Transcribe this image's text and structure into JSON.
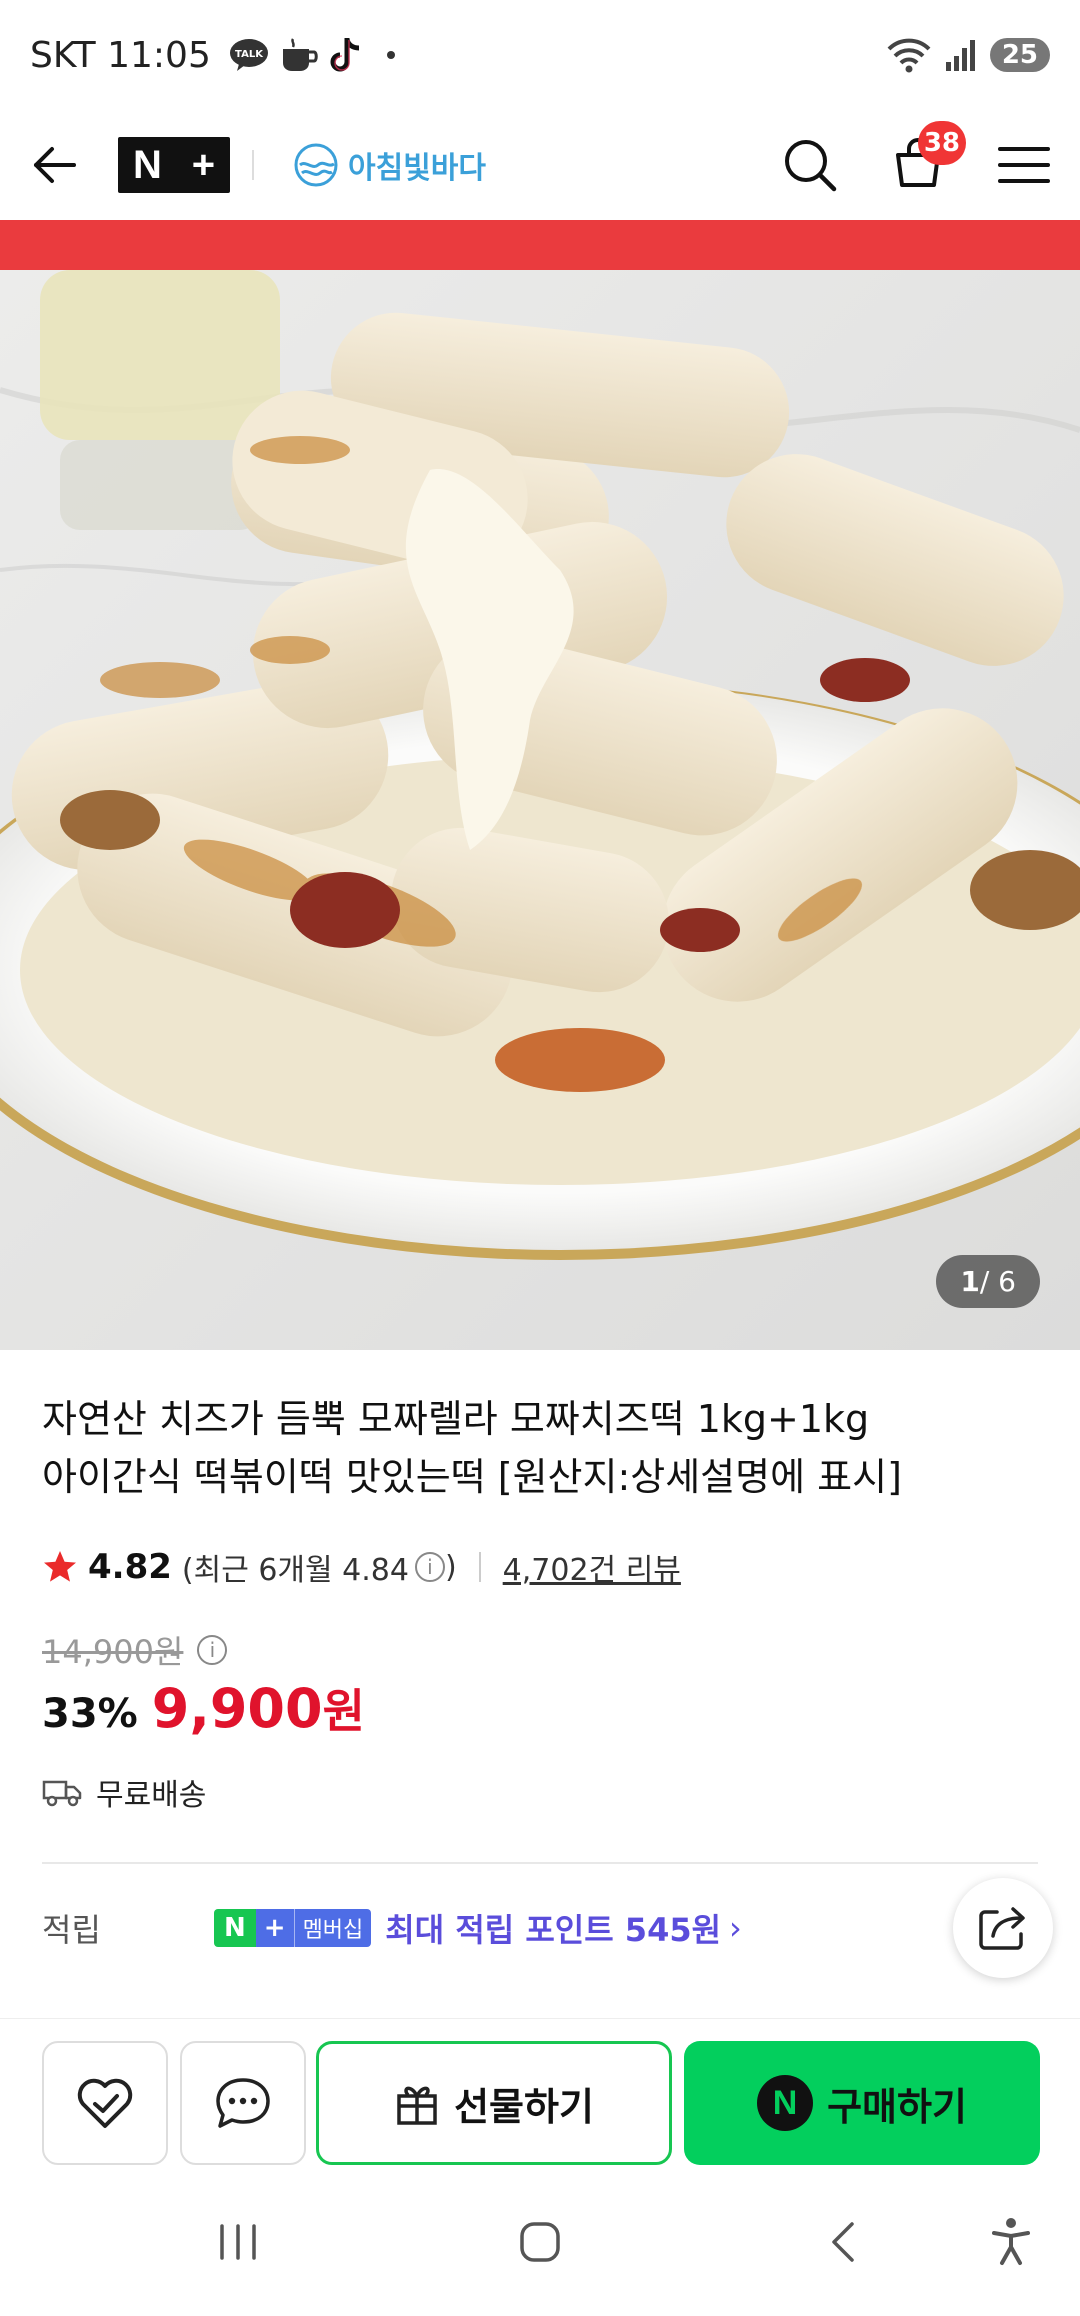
{
  "status_bar": {
    "carrier": "SKT",
    "time": "11:05",
    "battery": "25"
  },
  "header": {
    "brand_name": "아침빛바다",
    "cart_count": "38"
  },
  "gallery": {
    "current": "1",
    "total": "/ 6"
  },
  "product": {
    "title_line1": "자연산 치즈가 듬뿍 모짜렐라 모짜치즈떡 1kg+1kg",
    "title_line2": "아이간식 떡볶이떡 맛있는떡 [원산지:상세설명에 표시]",
    "rating": "4.82",
    "recent_rating": "(최근 6개월 4.84",
    "recent_rating_close": ")",
    "review_count": "4,702건 리뷰",
    "original_price": "14,900원",
    "discount": "33%",
    "price": "9,900",
    "currency": "원",
    "delivery": "무료배송"
  },
  "points": {
    "label": "적립",
    "badge_n": "N",
    "badge_plus": "+",
    "badge_membership": "멤버십",
    "text": "최대 적립 포인트 545원",
    "arrow": "›"
  },
  "bottom_bar": {
    "gift_label": "선물하기",
    "buy_label": "구매하기",
    "buy_icon_letter": "N"
  },
  "colors": {
    "accent_green": "#03cf5d",
    "price_red": "#e0132c",
    "points_purple": "#5a4ddb",
    "banner_red": "#ea3b3e"
  }
}
